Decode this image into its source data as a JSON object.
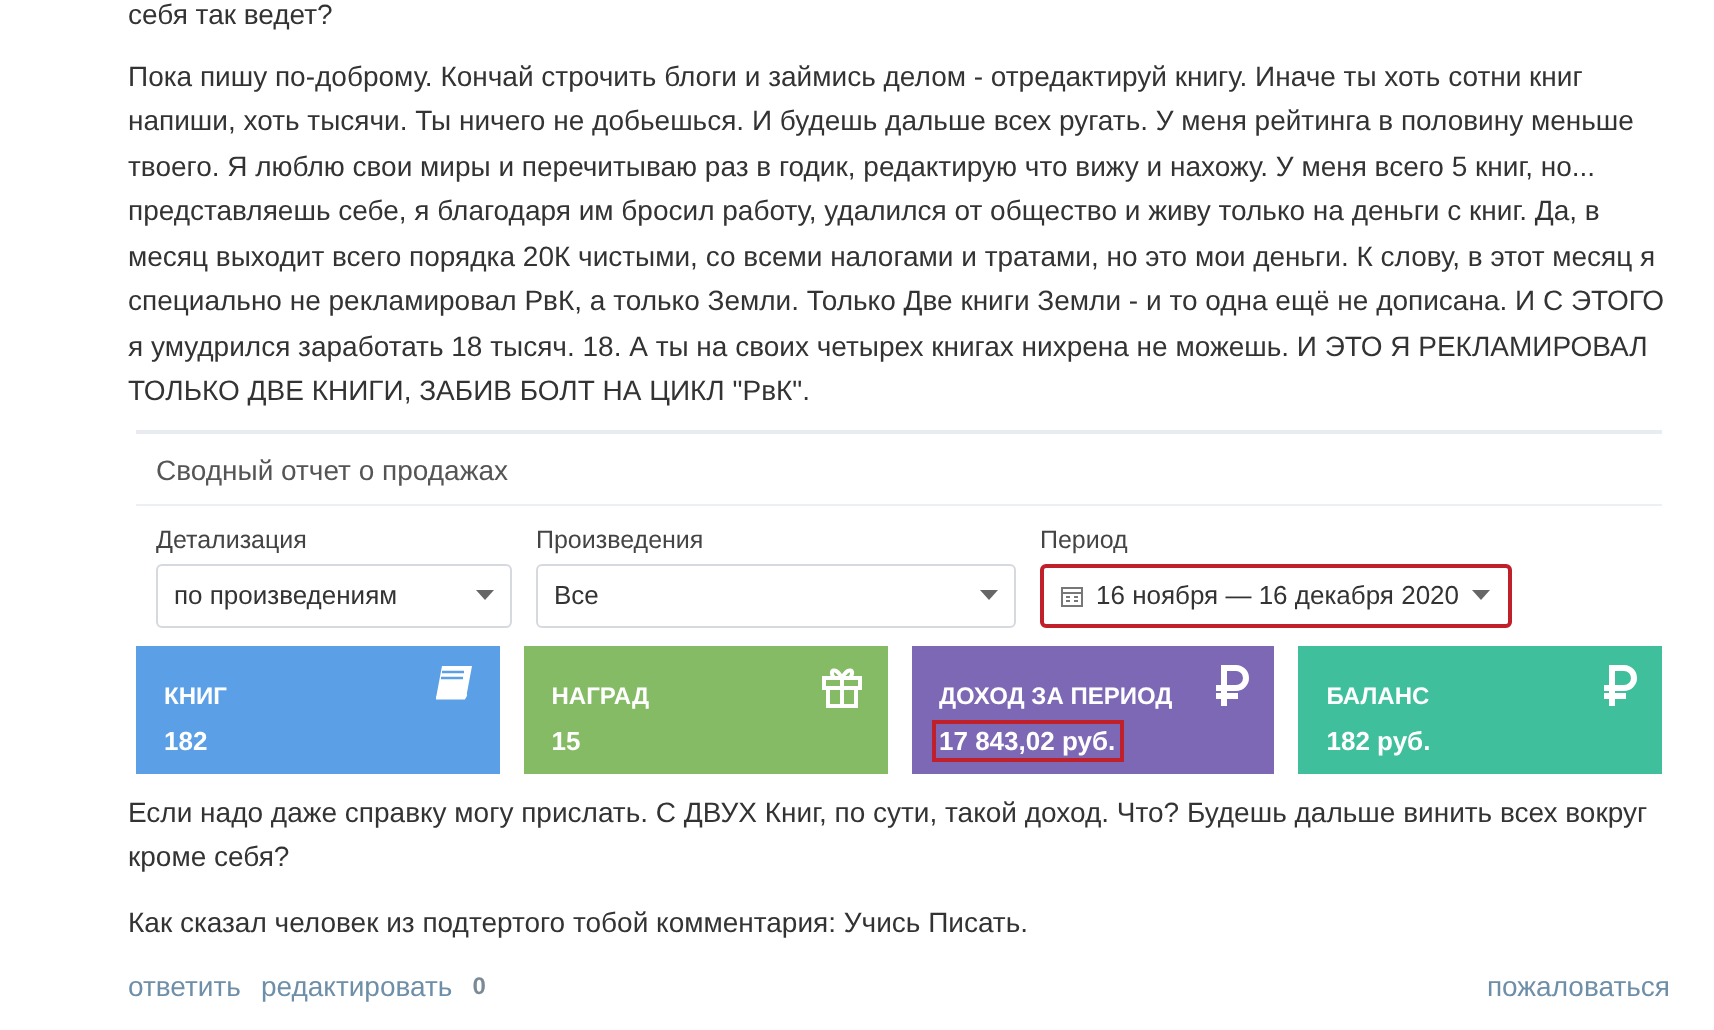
{
  "comment": {
    "lead_line": "себя так ведет?",
    "paragraph": "Пока пишу по-доброму. Кончай строчить блоги и займись делом - отредактируй книгу. Иначе ты хоть сотни книг напиши, хоть тысячи. Ты ничего не добьешься. И будешь дальше всех ругать. У меня рейтинга в половину меньше твоего. Я люблю свои миры и перечитываю раз в годик, редактирую что вижу и нахожу. У меня всего 5 книг, но... представляешь себе, я благодаря им бросил работу, удалился от общество и живу только на деньги с книг. Да, в месяц выходит всего порядка 20К чистыми, со всеми налогами и тратами, но это мои деньги. К слову, в этот месяц я специально не рекламировал РвК, а только Земли. Только Две книги Земли - и то одна ещё не дописана. И С ЭТОГО я умудрился заработать 18 тысяч. 18. А ты на своих четырех книгах нихрена не можешь. И ЭТО Я РЕКЛАМИРОВАЛ ТОЛЬКО ДВЕ КНИГИ, ЗАБИВ БОЛТ НА ЦИКЛ \"РвК\".",
    "report": {
      "title": "Сводный отчет о продажах",
      "filters": [
        {
          "kind": "select",
          "label": "Детализация",
          "value": "по произведениям",
          "highlighted": false
        },
        {
          "kind": "select",
          "label": "Произведения",
          "value": "Все",
          "highlighted": false
        },
        {
          "kind": "daterange",
          "label": "Период",
          "value": "16 ноября — 16 декабря 2020",
          "highlighted": true
        }
      ],
      "cards": [
        {
          "kind": "book",
          "label": "КНИГ",
          "value": "182",
          "color": "#5ba0e6",
          "highlighted": false
        },
        {
          "kind": "gift",
          "label": "НАГРАД",
          "value": "15",
          "color": "#85bb65",
          "highlighted": false
        },
        {
          "kind": "ruble",
          "label": "ДОХОД ЗА ПЕРИОД",
          "value": "17 843,02 руб.",
          "color": "#7d68b5",
          "highlighted": true
        },
        {
          "kind": "ruble",
          "label": "БАЛАНС",
          "value": "182 руб.",
          "color": "#3fbf9c",
          "highlighted": false
        }
      ]
    },
    "paragraphs": [
      "Если надо даже справку могу прислать. С ДВУХ Книг, по сути, такой доход. Что? Будешь дальше винить всех вокруг кроме себя?",
      "Как сказал человек из подтертого тобой комментария: Учись Писать."
    ],
    "actions": {
      "reply": "ответить",
      "edit": "редактировать",
      "count": "0",
      "report": "пожаловаться"
    }
  }
}
